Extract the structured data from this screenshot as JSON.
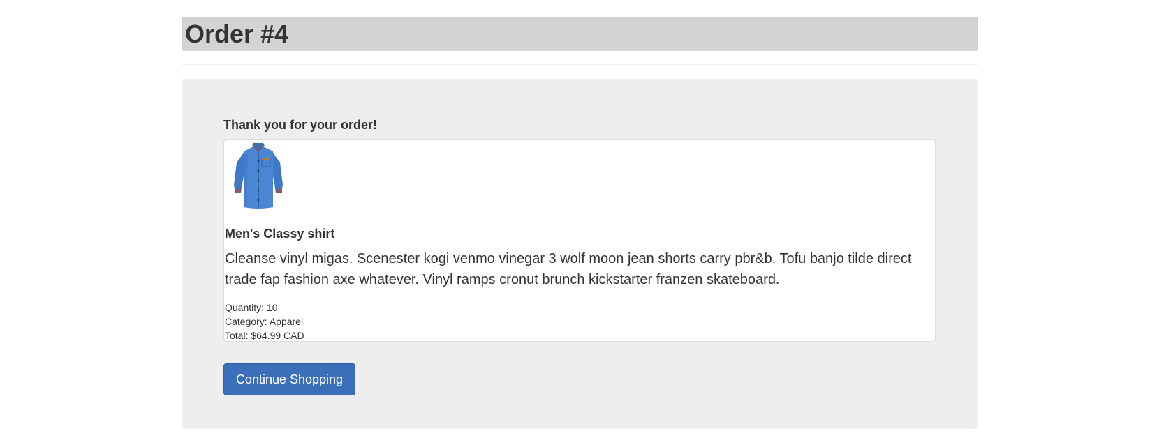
{
  "header": {
    "title": "Order #4"
  },
  "main": {
    "thank_you": "Thank you for your order!",
    "order": {
      "image_icon": "shirt-image",
      "product_name": "Men's Classy shirt",
      "description": "Cleanse vinyl migas. Scenester kogi venmo vinegar 3 wolf moon jean shorts carry pbr&b. Tofu banjo tilde direct trade fap fashion axe whatever. Vinyl ramps cronut brunch kickstarter franzen skateboard.",
      "quantity": "Quantity: 10",
      "category": "Category: Apparel",
      "total": "Total: $64.99 CAD"
    },
    "continue_label": "Continue Shopping"
  },
  "colors": {
    "header_bg": "#d3d3d3",
    "jumbotron_bg": "#eeeeee",
    "button_bg": "#3b6fba",
    "shirt_blue": "#4a86d4"
  }
}
